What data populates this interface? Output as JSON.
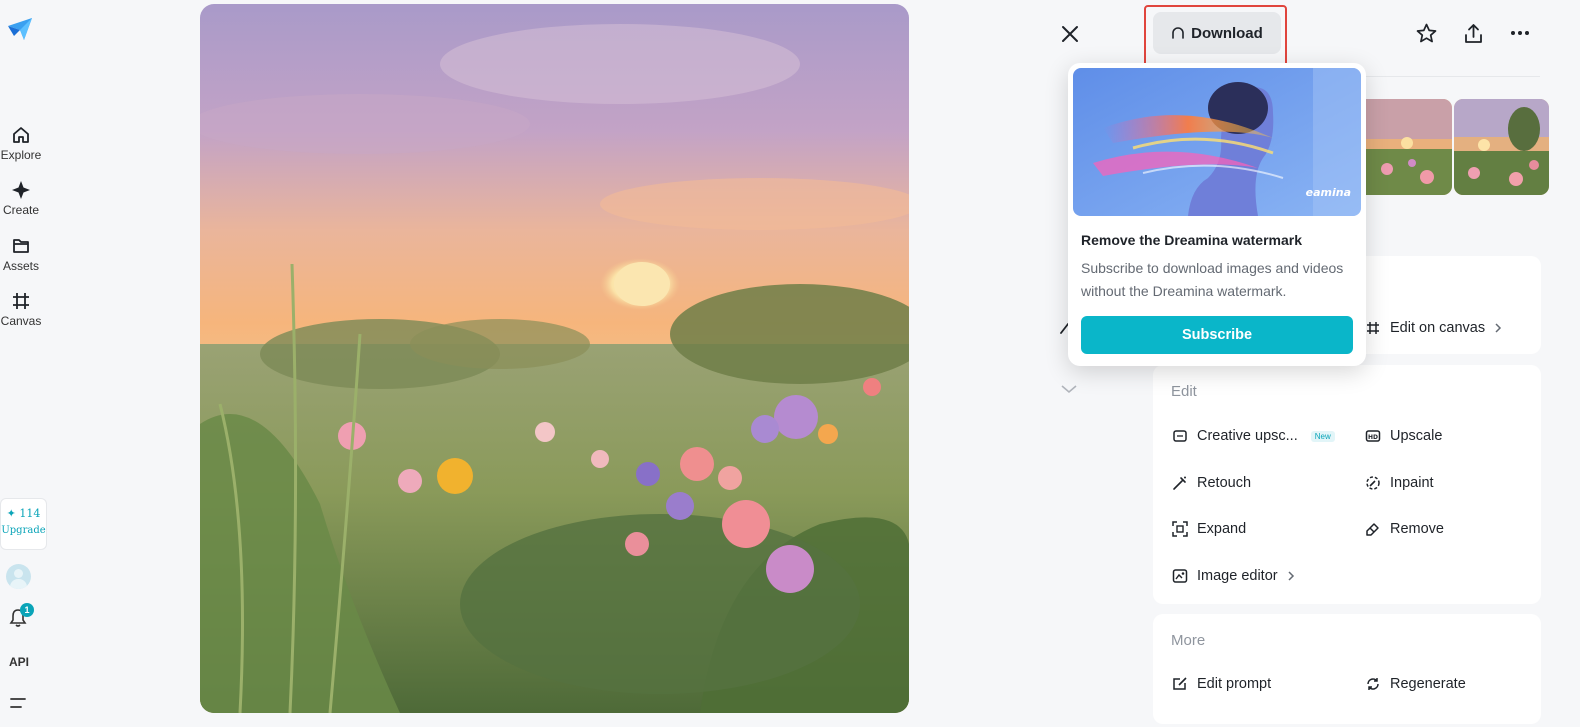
{
  "sidebar": {
    "items": [
      {
        "label": "Explore",
        "icon": "home-icon"
      },
      {
        "label": "Create",
        "icon": "sparkle-icon"
      },
      {
        "label": "Assets",
        "icon": "folder-icon"
      },
      {
        "label": "Canvas",
        "icon": "canvas-icon"
      }
    ],
    "credits_count": "✦ 114",
    "upgrade_label": "Upgrade",
    "notification_count": "1",
    "api_label": "API"
  },
  "toolbar": {
    "download_label": "Download"
  },
  "popover": {
    "title": "Remove the Dreamina watermark",
    "description": "Subscribe to download images and videos without the Dreamina watermark.",
    "subscribe_label": "Subscribe",
    "watermark_text": "eamina"
  },
  "panel": {
    "edit_on_canvas_label": "Edit on canvas",
    "edit_section": {
      "title": "Edit",
      "creative_upscale_label": "Creative upsc...",
      "new_badge": "New",
      "upscale_label": "Upscale",
      "retouch_label": "Retouch",
      "inpaint_label": "Inpaint",
      "expand_label": "Expand",
      "remove_label": "Remove",
      "image_editor_label": "Image editor"
    },
    "more_section": {
      "title": "More",
      "edit_prompt_label": "Edit prompt",
      "regenerate_label": "Regenerate"
    }
  },
  "colors": {
    "accent": "#0ab6c9",
    "highlight_box": "#e0453d"
  }
}
